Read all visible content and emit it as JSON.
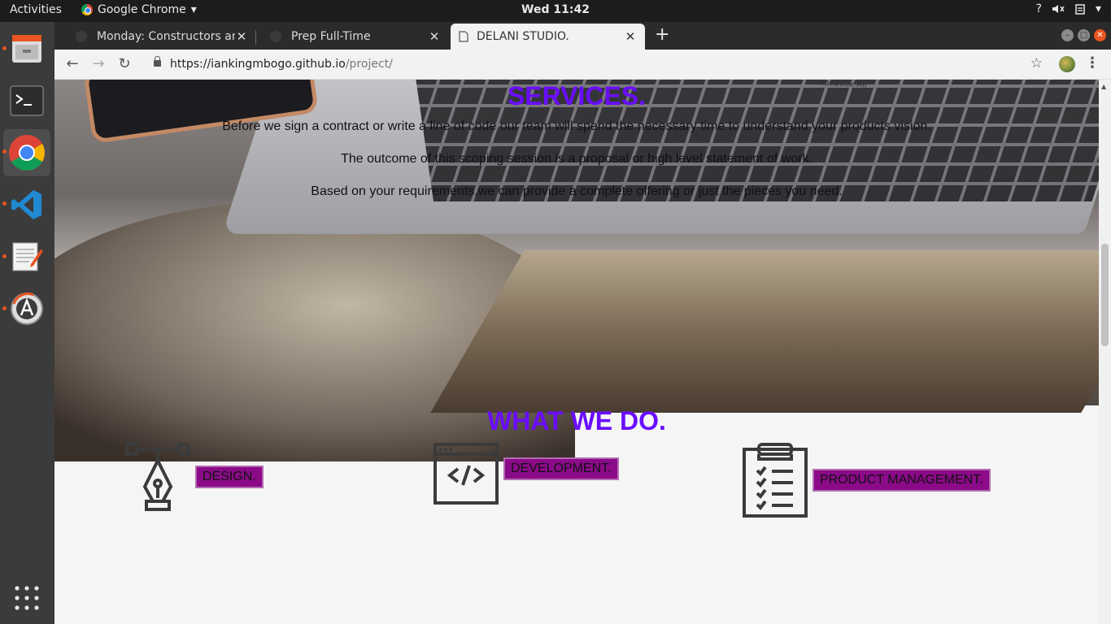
{
  "system": {
    "activities": "Activities",
    "app_name": "Google Chrome",
    "clock": "Wed 11:42",
    "tray_help": "?"
  },
  "browser": {
    "tabs": [
      {
        "title": "Monday: Constructors an",
        "active": false
      },
      {
        "title": "Prep Full-Time",
        "active": false
      },
      {
        "title": "DELANI STUDIO.",
        "active": true
      }
    ],
    "url_host": "https://iankingmbogo.github.io",
    "url_path": "/project/"
  },
  "page": {
    "services_title": "SERVICES.",
    "services_lines": [
      "Before we sign a contract or write a line of code our team will spend the necessary time to understand your products vision.",
      "The outcome of this scoping session is a proposal or high level statement of work.",
      "Based on your requirements,we can provide a complete offering or just the pieces you need."
    ],
    "hero_brand_text": "MacBook Air",
    "what_we_do_title": "WHAT WE DO.",
    "services": [
      {
        "label": "DESIGN.",
        "icon": "pen-tool-icon"
      },
      {
        "label": "DEVELOPMENT.",
        "icon": "code-window-icon"
      },
      {
        "label": "PRODUCT MANAGEMENT.",
        "icon": "clipboard-checklist-icon"
      }
    ]
  },
  "colors": {
    "accent_purple": "#6a0dff",
    "label_bg": "#8b0a88",
    "ubuntu_orange": "#e95420"
  }
}
